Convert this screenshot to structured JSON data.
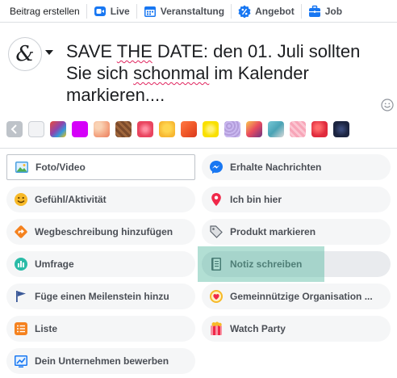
{
  "colors": {
    "tab_icon_blue": "#1877f2",
    "text_primary": "#1c1e21",
    "text_secondary": "#4b4f56",
    "pill_bg": "#f5f6f7",
    "highlight_overlay": "#54b7a0"
  },
  "tabs": [
    {
      "label": "Beitrag erstellen",
      "icon": null
    },
    {
      "label": "Live",
      "icon": "video-camera-icon"
    },
    {
      "label": "Veranstaltung",
      "icon": "calendar-icon"
    },
    {
      "label": "Angebot",
      "icon": "percent-tag-icon"
    },
    {
      "label": "Job",
      "icon": "briefcase-icon"
    }
  ],
  "composer": {
    "font_button_glyph": "&",
    "text_part1": "SAVE ",
    "text_misspelled1": "THE",
    "text_part2": " DATE: den 01. Juli sollten Sie sich ",
    "text_misspelled2": "schonmal",
    "text_part3": " im Kalender markieren...."
  },
  "backgrounds": [
    {
      "name": "back-arrow",
      "color": "#bec3c9"
    },
    {
      "name": "plain",
      "color": "#f2f3f5"
    },
    {
      "name": "multicolor-pattern",
      "color": "#8e44ad"
    },
    {
      "name": "magenta",
      "color": "#d500f9"
    },
    {
      "name": "peach-pattern",
      "color": "#f4a582"
    },
    {
      "name": "brown-pattern",
      "color": "#7b4a2b"
    },
    {
      "name": "strawberry-pattern",
      "color": "#e94560"
    },
    {
      "name": "yellow-emoji",
      "color": "#f7b731"
    },
    {
      "name": "orange-pattern",
      "color": "#f0592a"
    },
    {
      "name": "yellow-dots",
      "color": "#f9e000"
    },
    {
      "name": "lavender-pattern",
      "color": "#b39ddb"
    },
    {
      "name": "red-yellow-pattern",
      "color": "#e84a5f"
    },
    {
      "name": "teal-pattern",
      "color": "#4aa3b5"
    },
    {
      "name": "pink-pattern",
      "color": "#f8a5b8"
    },
    {
      "name": "red-pattern",
      "color": "#e02b3d"
    },
    {
      "name": "navy-pattern",
      "color": "#1c2540"
    }
  ],
  "actions": {
    "foto_video": "Foto/Video",
    "erhalte_nachrichten": "Erhalte Nachrichten",
    "gefuehl": "Gefühl/Aktivität",
    "ich_bin_hier": "Ich bin hier",
    "wegbeschreibung": "Wegbeschreibung hinzufügen",
    "produkt": "Produkt markieren",
    "umfrage": "Umfrage",
    "notiz": "Notiz schreiben",
    "meilenstein": "Füge einen Meilenstein hinzu",
    "gemeinnuetzig": "Gemeinnützige Organisation ...",
    "liste": "Liste",
    "watch_party": "Watch Party",
    "unternehmen": "Dein Unternehmen bewerben"
  }
}
